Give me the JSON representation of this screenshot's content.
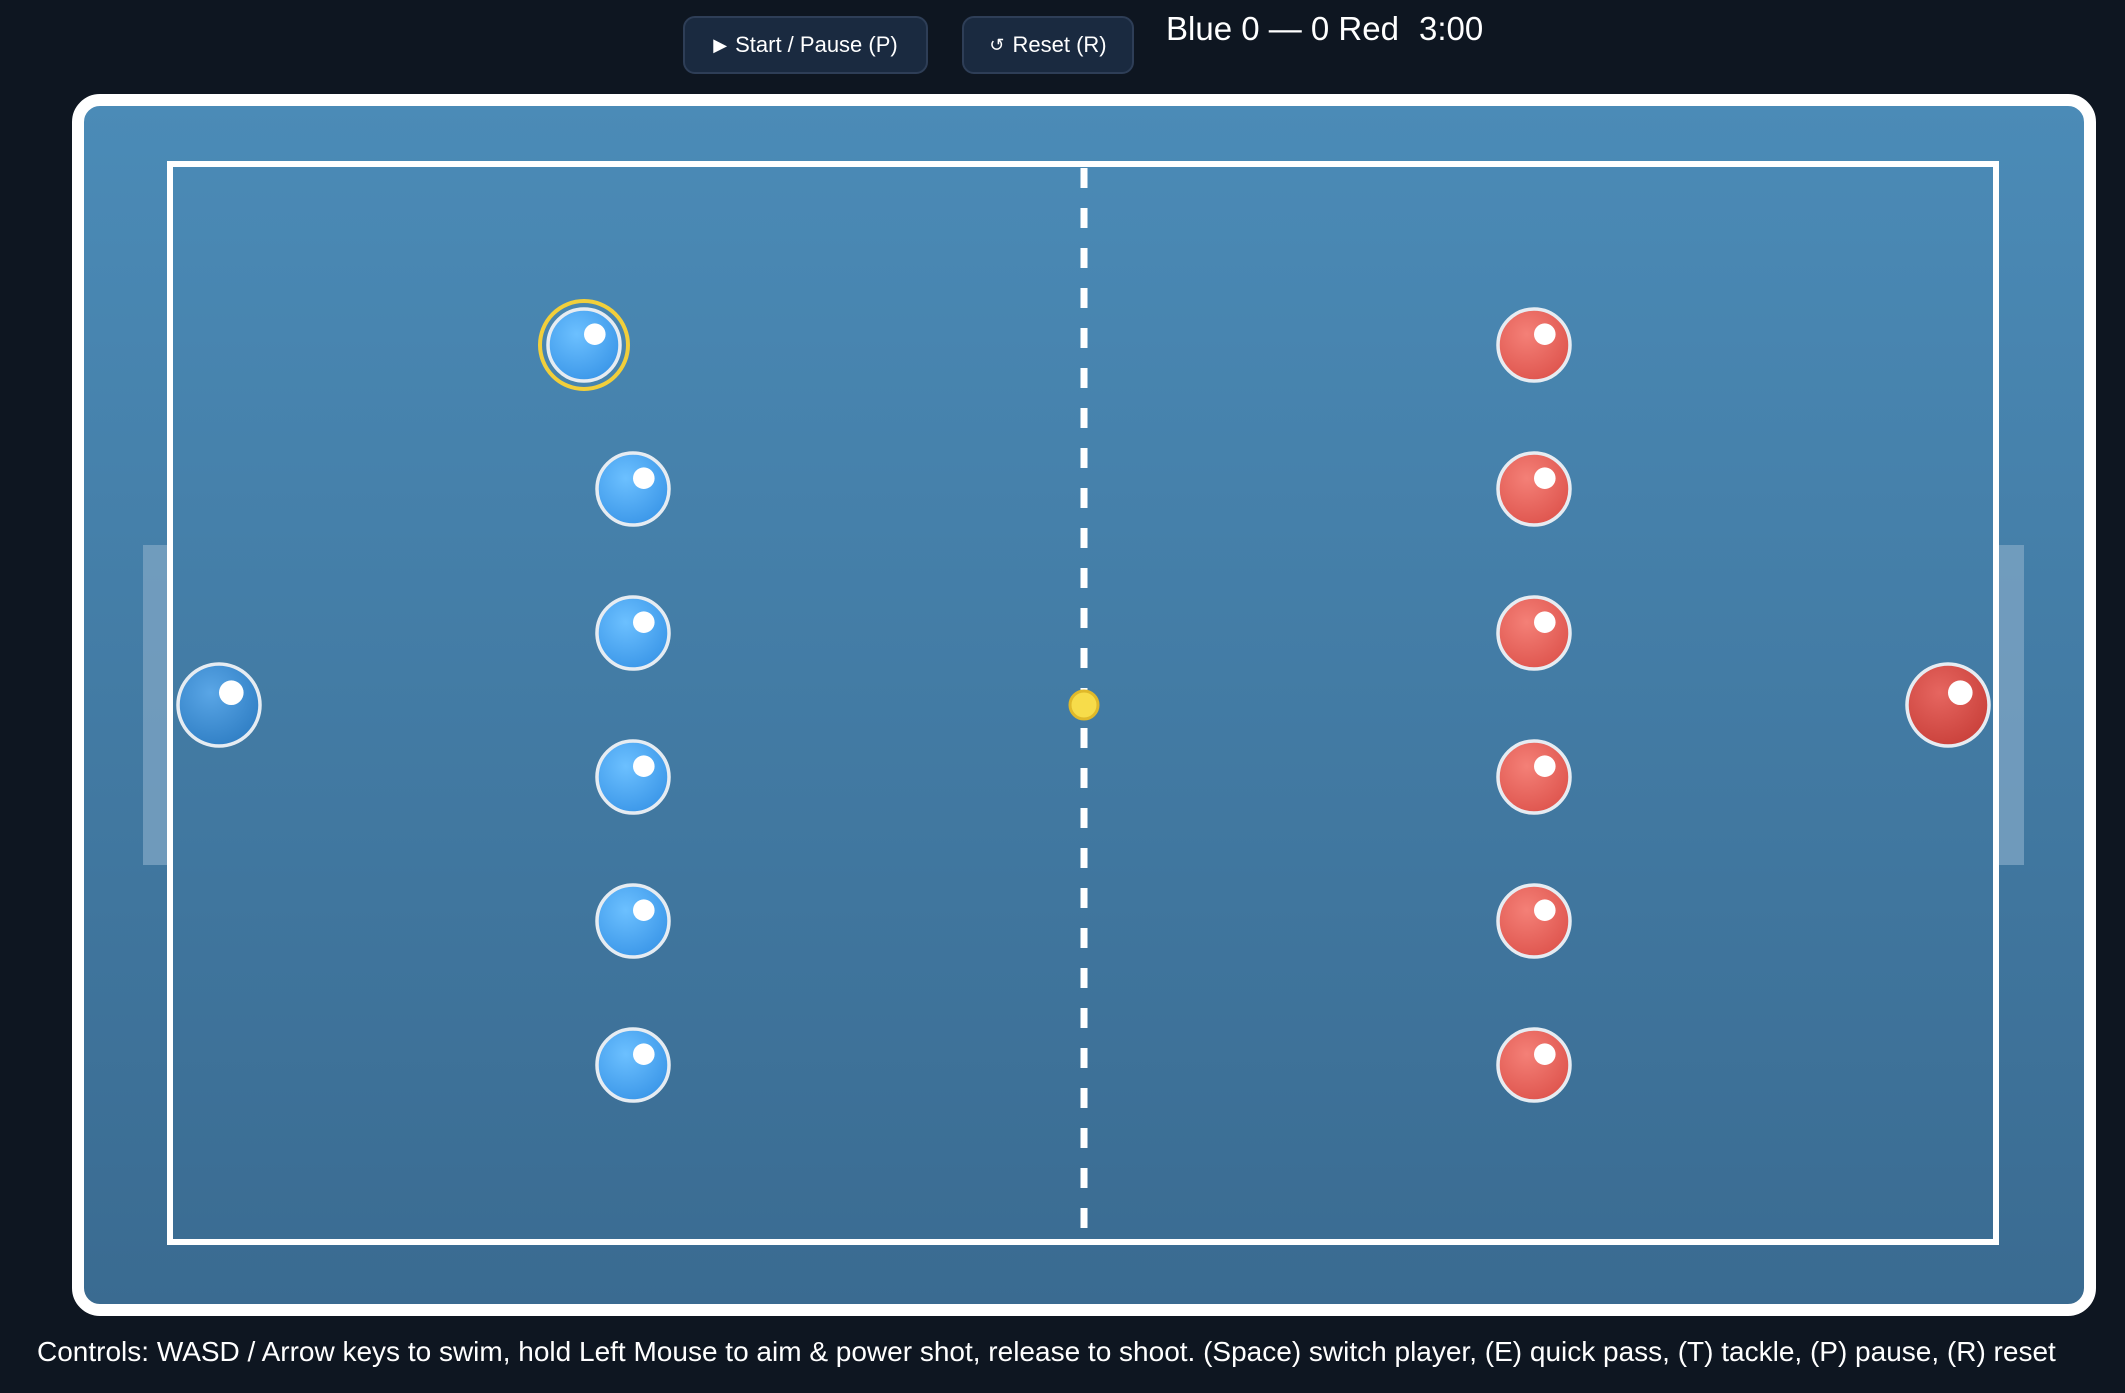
{
  "toolbar": {
    "start_label": "Start / Pause (P)",
    "start_icon": "play-icon",
    "reset_label": "Reset (R)",
    "reset_icon": "reset-icon"
  },
  "scoreboard": {
    "text": "Blue 0 — 0 Red",
    "blue_score": 0,
    "red_score": 0,
    "timer": "3:00"
  },
  "field": {
    "water_color_top": "#4b8bb7",
    "water_color_bottom": "#3a6b91",
    "line_color": "#ffffff"
  },
  "teams": {
    "blue": {
      "color": "#4aa8f0",
      "goalie_color": "#3d8fd6",
      "field_players": 6,
      "goalie": true,
      "selected_player": 1
    },
    "red": {
      "color": "#e8615a",
      "goalie_color": "#d24a44",
      "field_players": 6,
      "goalie": true
    }
  },
  "ball": {
    "color": "#f7dc4a"
  },
  "footer": {
    "controls_text": "Controls: WASD / Arrow keys to swim, hold Left Mouse to aim & power shot, release to shoot. (Space) switch player, (E) quick pass, (T) tackle, (P) pause, (R) reset"
  }
}
